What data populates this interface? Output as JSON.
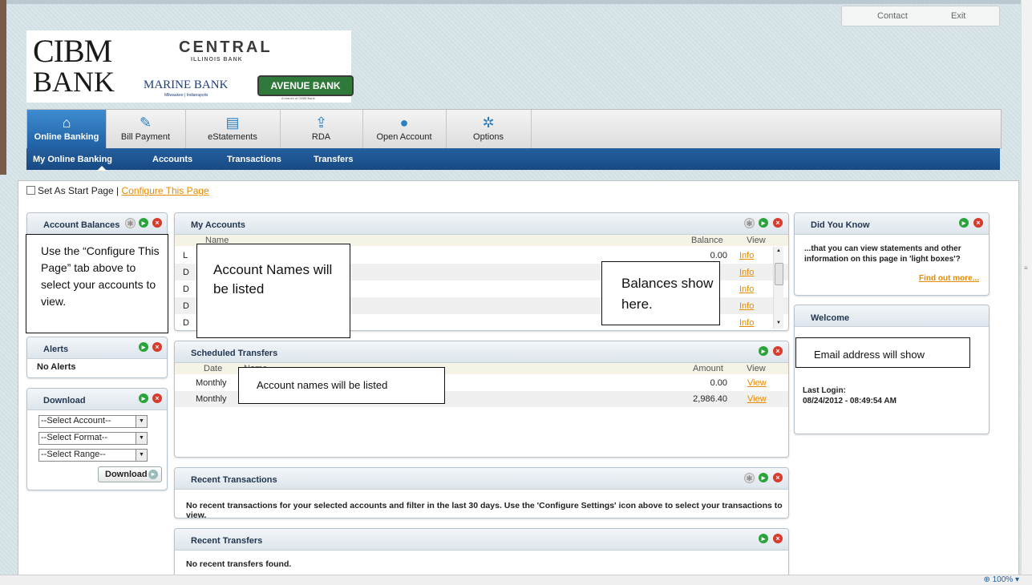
{
  "toplinks": {
    "contact": "Contact",
    "exit": "Exit"
  },
  "logo": {
    "cibm_line1": "CIBM",
    "cibm_line2": "BANK",
    "central": "CENTRAL",
    "illinois": "ILLINOIS BANK",
    "marine": "MARINE BANK",
    "marine_sub": "Milwaukee | Indianapolis",
    "avenue": "AVENUE BANK",
    "avenue_sub": "A branch of CIBM Bank"
  },
  "nav": {
    "tabs": [
      {
        "label": "Online Banking",
        "icon": "home-icon"
      },
      {
        "label": "Bill Payment",
        "icon": "bill-payment-icon"
      },
      {
        "label": "eStatements",
        "icon": "estatements-icon"
      },
      {
        "label": "RDA",
        "icon": "rda-icon"
      },
      {
        "label": "Open Account",
        "icon": "lightbulb-icon"
      },
      {
        "label": "Options",
        "icon": "gear-icon"
      }
    ],
    "subnav": [
      "My Online Banking",
      "Accounts",
      "Transactions",
      "Transfers"
    ]
  },
  "start": {
    "label": "Set As Start Page |",
    "link": "Configure This Page"
  },
  "balances_panel": {
    "title": "Account Balances",
    "callout": "Use the “Configure This Page” tab above to select your accounts to view."
  },
  "alerts": {
    "title": "Alerts",
    "text": "No Alerts"
  },
  "download": {
    "title": "Download",
    "account": "--Select Account--",
    "format": "--Select Format--",
    "range": "--Select Range--",
    "button": "Download"
  },
  "my_accounts": {
    "title": "My Accounts",
    "col_name": "Name",
    "col_balance": "Balance",
    "col_view": "View",
    "rows": [
      {
        "name": "L",
        "balance": "0.00",
        "view": "Info"
      },
      {
        "name": "D",
        "balance": "",
        "view": "Info"
      },
      {
        "name": "D",
        "balance": "",
        "view": "Info"
      },
      {
        "name": "D",
        "balance": "",
        "view": "Info"
      },
      {
        "name": "D",
        "balance": "",
        "view": "Info"
      }
    ],
    "callout_names": "Account Names will be listed",
    "callout_balances": "Balances show here."
  },
  "scheduled": {
    "title": "Scheduled Transfers",
    "col_date": "Date",
    "col_name": "Name",
    "col_amount": "Amount",
    "col_view": "View",
    "rows": [
      {
        "date": "Monthly",
        "amount": "0.00",
        "view": "View"
      },
      {
        "date": "Monthly",
        "amount": "2,986.40",
        "view": "View"
      }
    ],
    "callout": "Account names will be listed"
  },
  "recent_transactions": {
    "title": "Recent Transactions",
    "text": "No recent transactions for your selected accounts and filter in the last 30 days. Use the 'Configure Settings' icon above to select your transactions to view."
  },
  "recent_transfers": {
    "title": "Recent Transfers",
    "text": "No recent transfers found."
  },
  "did_you_know": {
    "title": "Did You Know",
    "text": "...that you can view statements and other information on this page in 'light boxes'?",
    "link": "Find out more..."
  },
  "welcome": {
    "title": "Welcome",
    "callout": "Email address will show",
    "last_login_label": "Last Login:",
    "last_login": "08/24/2012 - 08:49:54 AM"
  },
  "status": {
    "zoom": "100%"
  },
  "colors": {
    "nav_active": "#2f74ba",
    "subnav": "#1d5590",
    "link": "#e68a00",
    "add": "#2aa33a",
    "delete": "#d83b2b"
  }
}
